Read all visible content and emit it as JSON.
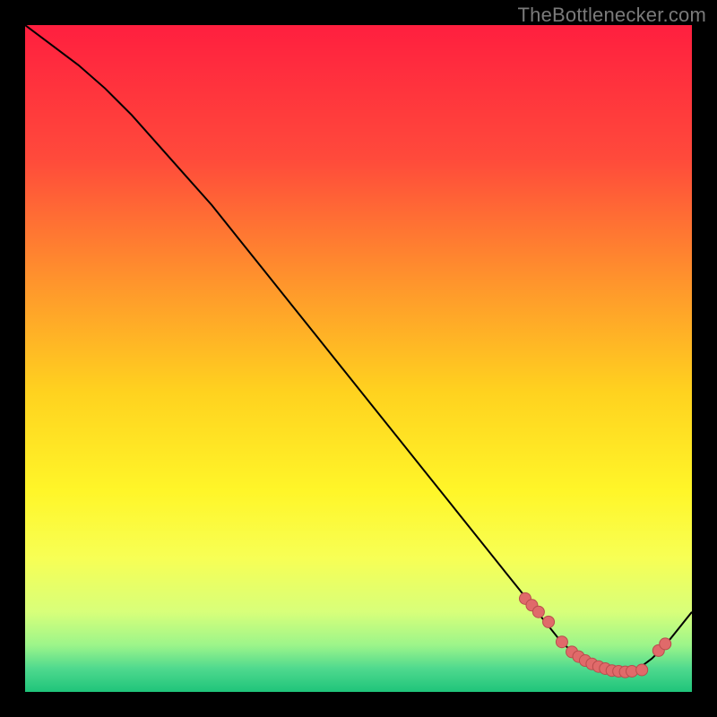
{
  "watermark": "TheBottlenecker.com",
  "colors": {
    "curve_stroke": "#000000",
    "dot_fill": "#e06a6a",
    "dot_stroke": "#b94d4d",
    "gradient_stops": [
      {
        "offset": 0.0,
        "color": "#ff1f3f"
      },
      {
        "offset": 0.2,
        "color": "#ff4a3b"
      },
      {
        "offset": 0.4,
        "color": "#ff9a2b"
      },
      {
        "offset": 0.55,
        "color": "#ffd21f"
      },
      {
        "offset": 0.7,
        "color": "#fff629"
      },
      {
        "offset": 0.8,
        "color": "#f7ff55"
      },
      {
        "offset": 0.88,
        "color": "#d8ff7a"
      },
      {
        "offset": 0.93,
        "color": "#9cf58a"
      },
      {
        "offset": 0.965,
        "color": "#4fd98e"
      },
      {
        "offset": 1.0,
        "color": "#1fc47a"
      }
    ]
  },
  "chart_data": {
    "type": "line",
    "title": "",
    "xlabel": "",
    "ylabel": "",
    "xlim": [
      0,
      100
    ],
    "ylim": [
      0,
      100
    ],
    "grid": false,
    "legend": false,
    "series": [
      {
        "name": "bottleneck-curve",
        "x": [
          0,
          4,
          8,
          12,
          16,
          20,
          24,
          28,
          32,
          36,
          40,
          44,
          48,
          52,
          56,
          60,
          64,
          68,
          72,
          74,
          76,
          78,
          80,
          82,
          84,
          86,
          88,
          90,
          92,
          94,
          96,
          98,
          100
        ],
        "y": [
          100,
          97,
          94,
          90.5,
          86.5,
          82,
          77.5,
          73,
          68,
          63,
          58,
          53,
          48,
          43,
          38,
          33,
          28,
          23,
          18,
          15.5,
          13,
          10.5,
          8,
          6,
          4.5,
          3.5,
          3,
          3,
          3.5,
          5,
          7,
          9.5,
          12
        ]
      }
    ],
    "dots": {
      "name": "highlight-dots",
      "x": [
        75,
        76,
        77,
        78.5,
        80.5,
        82,
        83,
        84,
        85,
        86,
        87,
        88,
        89,
        90,
        91,
        92.5,
        95,
        96
      ],
      "y": [
        14,
        13,
        12,
        10.5,
        7.5,
        6,
        5.3,
        4.7,
        4.2,
        3.8,
        3.5,
        3.2,
        3.1,
        3.0,
        3.1,
        3.3,
        6.2,
        7.2
      ]
    }
  }
}
